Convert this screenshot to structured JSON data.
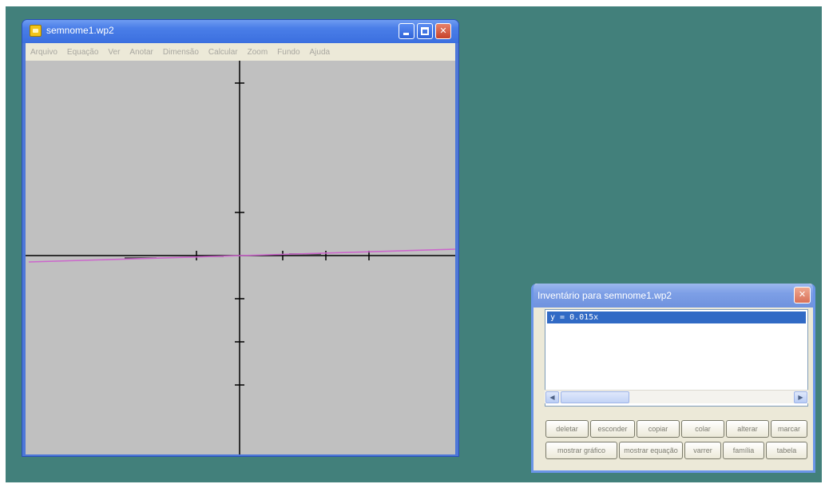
{
  "main_window": {
    "title": "semnome1.wp2",
    "menu": [
      "Arquivo",
      "Equação",
      "Ver",
      "Anotar",
      "Dimensão",
      "Calcular",
      "Zoom",
      "Fundo",
      "Ajuda"
    ]
  },
  "graph": {
    "curve_color": "#cc66cc",
    "axis_color": "#000000",
    "background": "#c0c0c0"
  },
  "inventory": {
    "title": "Inventário para semnome1.wp2",
    "items": [
      "y = 0.015x"
    ],
    "buttons_row1": [
      "deletar",
      "esconder",
      "copiar",
      "colar",
      "alterar",
      "marcar"
    ],
    "buttons_row2": [
      "mostrar gráfico",
      "mostrar equação",
      "varrer",
      "família",
      "tabela"
    ]
  }
}
